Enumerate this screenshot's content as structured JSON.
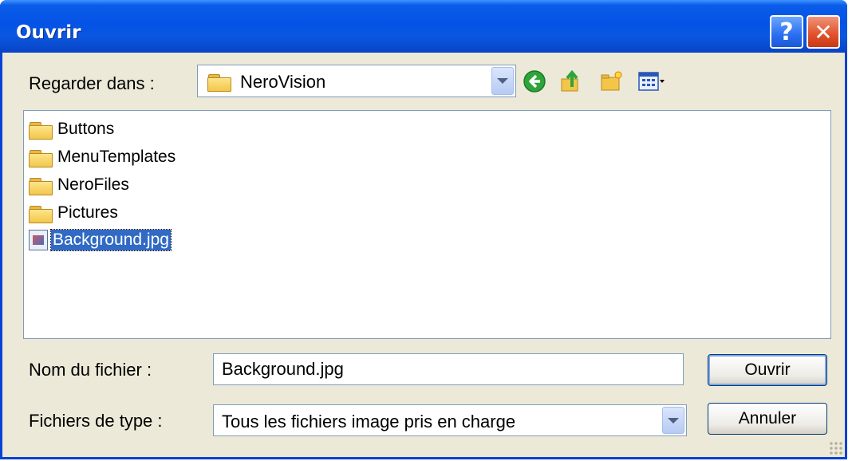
{
  "window": {
    "title": "Ouvrir",
    "help_glyph": "?",
    "close_glyph": "✕"
  },
  "lookin": {
    "label": "Regarder dans :",
    "value": "NeroVision",
    "icons": [
      "back-icon",
      "up-folder-icon",
      "new-folder-icon",
      "view-menu-icon"
    ]
  },
  "files": [
    {
      "name": "Buttons",
      "type": "folder",
      "selected": false
    },
    {
      "name": "MenuTemplates",
      "type": "folder",
      "selected": false
    },
    {
      "name": "NeroFiles",
      "type": "folder",
      "selected": false
    },
    {
      "name": "Pictures",
      "type": "folder",
      "selected": false
    },
    {
      "name": "Background.jpg",
      "type": "image",
      "selected": true
    }
  ],
  "filename": {
    "label": "Nom du fichier :",
    "value": "Background.jpg"
  },
  "filetype": {
    "label": "Fichiers de type :",
    "value": "Tous les fichiers image pris en charge"
  },
  "buttons": {
    "open": "Ouvrir",
    "cancel": "Annuler"
  },
  "colors": {
    "titlebar": "#0553e6",
    "selection": "#316ac5",
    "dialog_bg": "#ece9d8"
  }
}
